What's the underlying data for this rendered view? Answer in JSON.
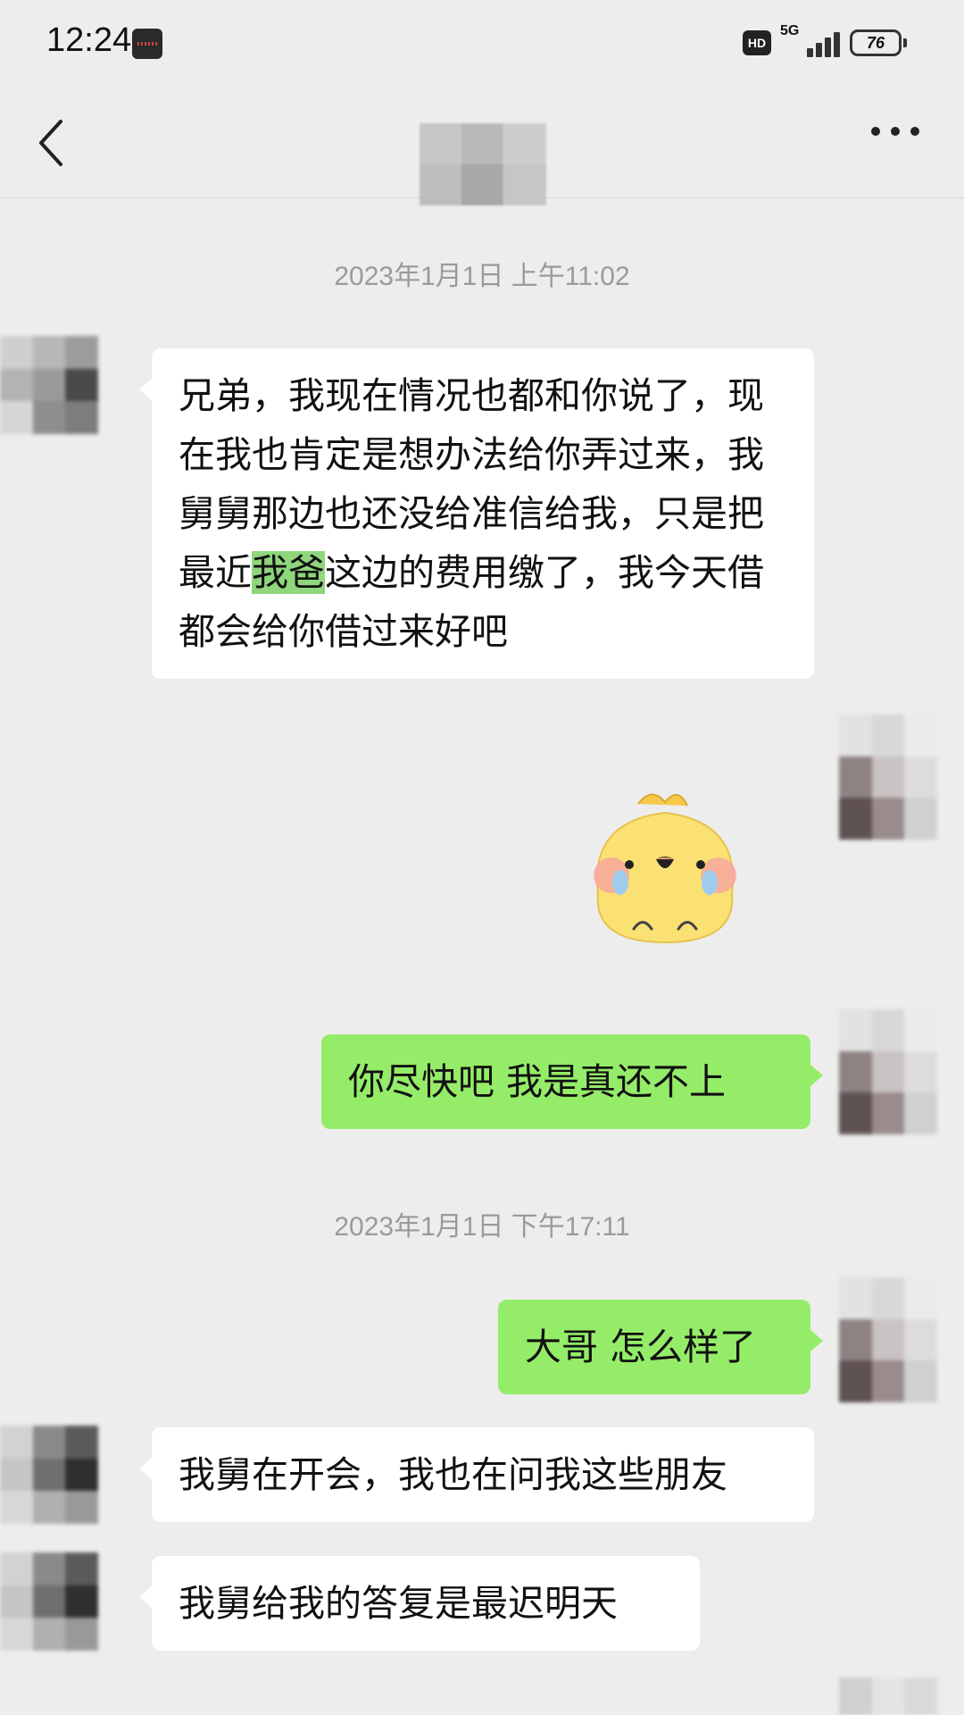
{
  "status_bar": {
    "time": "12:24",
    "hd": "HD",
    "network": "5G",
    "battery": "76"
  },
  "nav": {
    "back_icon": "chevron-left-icon",
    "more_icon": "more-dots-icon"
  },
  "colors": {
    "background": "#ededed",
    "incoming_bubble": "#ffffff",
    "outgoing_bubble": "#95ec69",
    "timestamp_text": "#9a9a9a"
  },
  "messages": {
    "ts1": "2023年1月1日 上午11:02",
    "m1_pre": "兄弟，我现在情况也都和你说了，现在我也肯定是想办法给你弄过来，我舅舅那边也还没给准信给我，只是把最近",
    "m1_hl": "我爸",
    "m1_post": "这边的费用缴了，我今天借都会给你借过来好吧",
    "sticker": "crying-chick-sticker",
    "m2": "你尽快吧 我是真还不上",
    "ts2": "2023年1月1日 下午17:11",
    "m3": "大哥 怎么样了",
    "m4": "我舅在开会，我也在问我这些朋友",
    "m5": "我舅给我的答复是最迟明天"
  }
}
